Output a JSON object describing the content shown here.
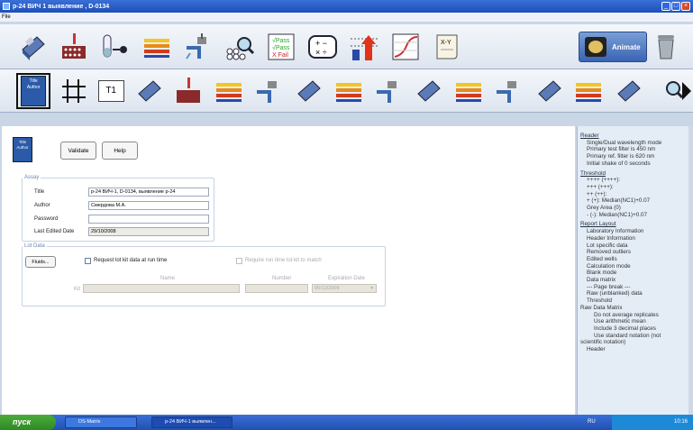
{
  "window": {
    "title": "р-24 ВИЧ 1 выявление , D-0134"
  },
  "menu": {
    "file": "File"
  },
  "toolbar1": {
    "icons": [
      "plate-reader-icon",
      "plate-pipette-icon",
      "test-tube-icon",
      "gradient-bars-icon",
      "pipette-wash-icon",
      "magnifier-wells-icon",
      "pass-fail-icon",
      "calculator-icon",
      "threshold-arrow-icon",
      "curve-graph-icon",
      "xy-scroll-icon"
    ],
    "pass_fail_text": [
      "√Pass",
      "√Pass",
      "X Fail"
    ],
    "xy_text": "X-Y",
    "animate_label": "Animate"
  },
  "toolbar2": {
    "card_text": [
      "Title",
      "Author"
    ],
    "t1_label": "T1"
  },
  "main": {
    "card_text": [
      "Title",
      "Author"
    ],
    "validate_label": "Validate",
    "help_label": "Help",
    "assay": {
      "legend": "Assay",
      "title_label": "Title",
      "title_value": "р-24 ВИЧ-1, D-0134, выявление р-24",
      "author_label": "Author",
      "author_value": "Смердова М.А.",
      "password_label": "Password",
      "password_value": "",
      "last_edited_label": "Last Edited Date",
      "last_edited_value": "29/10/2008"
    },
    "lot": {
      "legend": "Lot Data",
      "fluids_label": "Fluids...",
      "request_label": "Request lot kit data at run time",
      "require_label": "Require run time lot kit to match",
      "name_header": "Name",
      "number_header": "Number",
      "expiration_header": "Expiration Date",
      "kit_label": "Kit",
      "expiration_value": "05/12/2008"
    }
  },
  "report": {
    "sections": [
      {
        "head": "Reader",
        "items": [
          {
            "t": "Single/Dual wavelength mode",
            "lvl": 1
          },
          {
            "t": "Primary test filter is 450 nm",
            "lvl": 1
          },
          {
            "t": "Primary ref. filter is 620 nm",
            "lvl": 1
          },
          {
            "t": "Initial shake of 0 seconds",
            "lvl": 1
          }
        ]
      },
      {
        "head": "Threshold",
        "items": [
          {
            "t": "++++ (++++):",
            "lvl": 1
          },
          {
            "t": "+++ (+++):",
            "lvl": 1
          },
          {
            "t": "++ (++):",
            "lvl": 1
          },
          {
            "t": "+ (+): Median(NC1)+0.07",
            "lvl": 1
          },
          {
            "t": "Grey Area (0)",
            "lvl": 1
          },
          {
            "t": "- (-): Median(NC1)+0.07",
            "lvl": 1
          }
        ]
      },
      {
        "head": "Report Layout",
        "items": [
          {
            "t": "Laboratory Information",
            "lvl": 1
          },
          {
            "t": "Header Information",
            "lvl": 1
          },
          {
            "t": "Lot specific data",
            "lvl": 1
          },
          {
            "t": "Removed outliers",
            "lvl": 1
          },
          {
            "t": "Edited wells",
            "lvl": 1
          },
          {
            "t": "Calculation mode",
            "lvl": 1
          },
          {
            "t": "Blank mode",
            "lvl": 1
          },
          {
            "t": "Data matrix",
            "lvl": 1
          },
          {
            "t": "--- Page break ---",
            "lvl": 1
          },
          {
            "t": "Raw (unblanked) data",
            "lvl": 1
          },
          {
            "t": "Threshold",
            "lvl": 1
          },
          {
            "t": "Raw Data Matrix",
            "lvl": 0
          },
          {
            "t": "Do not average replicates",
            "lvl": 2
          },
          {
            "t": "Use arithmetic mean",
            "lvl": 2
          },
          {
            "t": "Include 3 decimal places",
            "lvl": 2
          },
          {
            "t": "Use standard notation (not",
            "lvl": 2
          },
          {
            "t": "scientific notation)",
            "lvl": 0
          },
          {
            "t": "Header",
            "lvl": 1
          }
        ]
      }
    ]
  },
  "taskbar": {
    "start_label": "пуск",
    "task1": "DS-Matrix",
    "task2": "р-24 ВИЧ-1 выявлен...",
    "lang": "RU",
    "clock": "10:16"
  },
  "colors": {
    "titlebar": "#1c4fb8",
    "card": "#2a5aa8",
    "panel": "#e4ecf6"
  }
}
